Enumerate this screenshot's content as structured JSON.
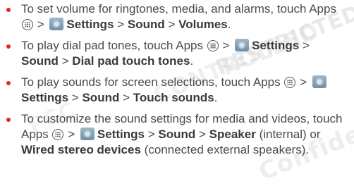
{
  "watermark": [
    "CONTROLLED",
    "RESTRICTED",
    "FCC",
    "Confidential"
  ],
  "accent": "#e8232a",
  "items": [
    {
      "prefix": "To set volume for ringtones, media, and alarms, touch Apps",
      "gt": ">",
      "settings": "Settings",
      "sound": "Sound",
      "target": "Volumes",
      "suffix": "."
    },
    {
      "prefix": "To play dial pad tones, touch Apps",
      "gt": ">",
      "settings": "Settings",
      "sound": "Sound",
      "target": "Dial pad touch tones",
      "suffix": "."
    },
    {
      "prefix": "To play sounds for screen selections, touch Apps",
      "gt": ">",
      "settings": "Settings",
      "sound": "Sound",
      "target": "Touch sounds",
      "suffix": "."
    },
    {
      "prefix": "To customize the sound settings for media and videos, touch Apps",
      "gt": ">",
      "settings": "Settings",
      "sound": "Sound",
      "target": "Speaker",
      "target_note": "(internal) or",
      "target2": "Wired stereo devices",
      "suffix": "(connected external speakers)."
    }
  ]
}
